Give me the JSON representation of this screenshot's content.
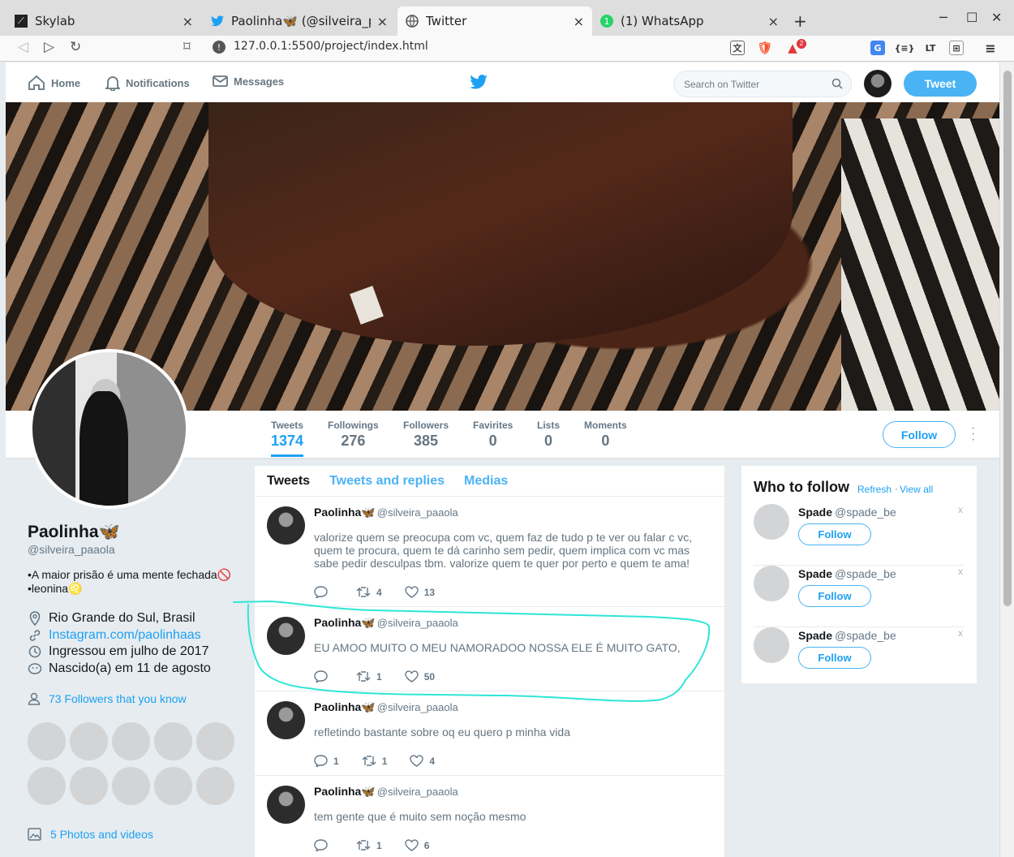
{
  "browser": {
    "tabs": [
      {
        "title": "Skylab",
        "active": false
      },
      {
        "title": "Paolinha🦋 (@silveira_paa",
        "active": false
      },
      {
        "title": "Twitter",
        "active": true
      },
      {
        "title": "(1) WhatsApp",
        "active": false
      }
    ],
    "new_tab": "+",
    "url": "127.0.0.1:5500/project/index.html",
    "brave_badge": "2"
  },
  "nav": {
    "home": "Home",
    "notifications": "Notifications",
    "messages": "Messages",
    "search_placeholder": "Search on Twitter",
    "tweet_button": "Tweet"
  },
  "stats": [
    {
      "label": "Tweets",
      "value": "1374",
      "active": true
    },
    {
      "label": "Followings",
      "value": "276"
    },
    {
      "label": "Followers",
      "value": "385"
    },
    {
      "label": "Favirites",
      "value": "0"
    },
    {
      "label": "Lists",
      "value": "0"
    },
    {
      "label": "Moments",
      "value": "0"
    }
  ],
  "follow_button": "Follow",
  "profile": {
    "name": "Paolinha🦋",
    "handle": "@silveira_paaola",
    "bio_line1": "•A maior prisão é uma mente fechada🚫",
    "bio_line2": "•leonina♌",
    "location": "Rio Grande do Sul, Brasil",
    "website": "Instagram.com/paolinhaas",
    "joined": "Ingressou em julho de 2017",
    "birthday": "Nascido(a) em 11 de agosto",
    "followers_you_know": "73 Followers that you know",
    "photos": "5 Photos and videos"
  },
  "timeline": {
    "tabs": [
      "Tweets",
      "Tweets and replies",
      "Medias"
    ],
    "tweets": [
      {
        "name": "Paolinha🦋",
        "handle": "@silveira_paaola",
        "text": "valorize quem se preocupa com vc, quem faz de tudo p te ver ou falar c vc, quem te procura, quem te dá carinho sem pedir, quem implica com vc mas sabe pedir desculpas tbm. valorize quem te quer por perto e quem te ama!",
        "replies": "",
        "retweets": "4",
        "likes": "13"
      },
      {
        "name": "Paolinha🦋",
        "handle": "@silveira_paaola",
        "text": "EU AMOO MUITO O MEU NAMORADOO NOSSA ELE É MUITO GATO,",
        "replies": "",
        "retweets": "1",
        "likes": "50"
      },
      {
        "name": "Paolinha🦋",
        "handle": "@silveira_paaola",
        "text": "refletindo bastante sobre oq eu quero p minha vida",
        "replies": "1",
        "retweets": "1",
        "likes": "4"
      },
      {
        "name": "Paolinha🦋",
        "handle": "@silveira_paaola",
        "text": "tem gente que é muito sem noção mesmo",
        "replies": "",
        "retweets": "1",
        "likes": "6"
      }
    ]
  },
  "who_to_follow": {
    "title": "Who to follow",
    "refresh": "Refresh",
    "separator": "·",
    "view_all": "View all",
    "suggestions": [
      {
        "name": "Spade",
        "handle": "@spade_be",
        "button": "Follow",
        "close": "x"
      },
      {
        "name": "Spade",
        "handle": "@spade_be",
        "button": "Follow",
        "close": "x"
      },
      {
        "name": "Spade",
        "handle": "@spade_be",
        "button": "Follow",
        "close": "x"
      }
    ]
  },
  "colors": {
    "accent": "#1da1f2",
    "button": "#4ab3f4",
    "annotation": "#2ee6d6"
  }
}
